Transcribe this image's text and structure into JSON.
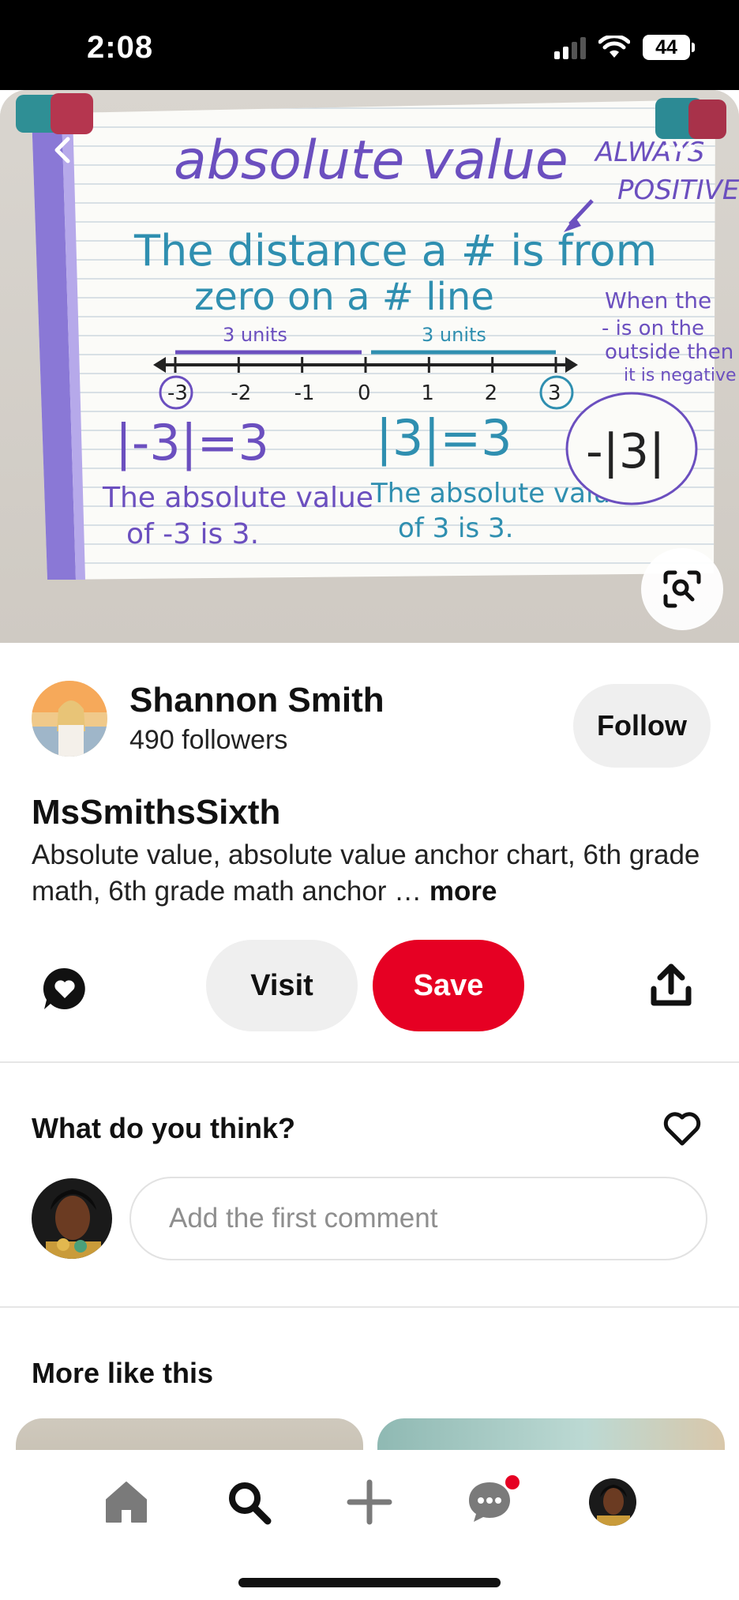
{
  "status_bar": {
    "time": "2:08",
    "battery_level": "44",
    "signal_bars_active": 2,
    "signal_bars_total": 4
  },
  "pin": {
    "image": {
      "chart_title": "absolute value",
      "definition_line1": "The distance a # is from",
      "definition_line2": "zero on a # line",
      "always_positive_line1": "ALWAYS",
      "always_positive_line2": "POSITIVE",
      "units_left": "3 units",
      "units_right": "3 units",
      "ticks": [
        "-3",
        "-2",
        "-1",
        "0",
        "1",
        "2",
        "3"
      ],
      "example1": "|-3|=3",
      "example2": "|3|=3",
      "example1_caption_line1": "The absolute value",
      "example1_caption_line2": "of -3 is 3.",
      "example2_caption_line1": "The absolute value",
      "example2_caption_line2": "of 3 is 3.",
      "note_line1": "When the",
      "note_line2": "- is on the",
      "note_line3": "outside then",
      "note_line4": "it is negative",
      "bubble_text": "-|3|"
    },
    "creator": {
      "name": "Shannon Smith",
      "followers": "490 followers",
      "follow_label": "Follow"
    },
    "title": "MsSmithsSixth",
    "description": "Absolute value, absolute value anchor chart, 6th grade math, 6th grade math anchor …",
    "more_label": "more",
    "actions": {
      "visit_label": "Visit",
      "save_label": "Save"
    }
  },
  "comments": {
    "heading": "What do you think?",
    "input_placeholder": "Add the first comment"
  },
  "more_like_this": {
    "heading": "More like this"
  },
  "tab_bar": {
    "active": "search",
    "tabs": [
      "home-icon",
      "search-icon",
      "plus-icon",
      "chat-icon",
      "profile-avatar"
    ],
    "messages_has_notification": true
  },
  "colors": {
    "brand_red": "#e60023",
    "chart_purple": "#6b4fbf",
    "chart_teal": "#2f8fb0"
  }
}
